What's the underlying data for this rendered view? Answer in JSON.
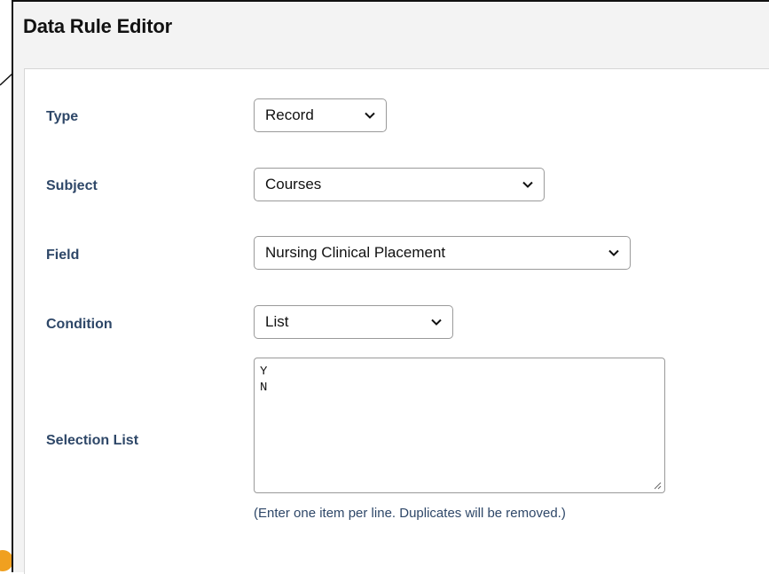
{
  "dialog": {
    "title": "Data Rule Editor"
  },
  "form": {
    "type": {
      "label": "Type",
      "value": "Record"
    },
    "subject": {
      "label": "Subject",
      "value": "Courses"
    },
    "field": {
      "label": "Field",
      "value": "Nursing Clinical Placement"
    },
    "condition": {
      "label": "Condition",
      "value": "List"
    },
    "selection_list": {
      "label": "Selection List",
      "lines": [
        "Y",
        "N"
      ],
      "help": "(Enter one item per line. Duplicates will be removed.)"
    }
  },
  "icons": {
    "select_chevron": "chevron-down-icon",
    "textarea_resize": "resize-handle-icon"
  },
  "colors": {
    "label": "#2e4768",
    "border": "#9a9a9a",
    "badge": "#f0a020"
  }
}
